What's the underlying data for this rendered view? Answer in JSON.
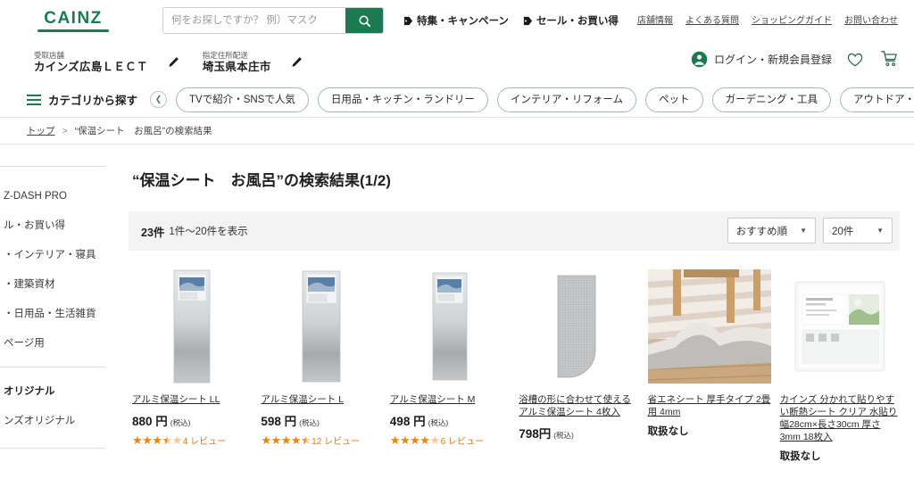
{
  "header": {
    "logo_text": "CAINZ",
    "search": {
      "placeholder": "何をお探しですか？ 例）マスク",
      "value": "",
      "button_icon": "search-icon"
    },
    "promo_links": [
      {
        "label": "特集・キャンペーン",
        "icon": "tag-icon"
      },
      {
        "label": "セール・お買い得",
        "icon": "tag-icon"
      }
    ],
    "util_links": [
      "店舗情報",
      "よくある質問",
      "ショッピングガイド",
      "お問い合わせ"
    ]
  },
  "store_row": {
    "pickup": {
      "label": "受取店舗",
      "value": "カインズ広島ＬＥＣＴ",
      "edit_icon": "pencil-icon"
    },
    "delivery": {
      "label": "指定住所配送",
      "value": "埼玉県本庄市",
      "edit_icon": "pencil-icon"
    },
    "account": {
      "label": "ログイン・新規会員登録",
      "person_icon": "person-icon",
      "favorite_icon": "heart-icon",
      "cart_icon": "cart-icon"
    }
  },
  "category_nav": {
    "menu_label": "カテゴリから探す",
    "prev_icon": "chevron-left-icon",
    "next_icon": "chevron-right-icon",
    "chips": [
      "TVで紹介・SNSで人気",
      "日用品・キッチン・ランドリー",
      "インテリア・リフォーム",
      "ペット",
      "ガーデニング・工具",
      "アウトドア・ス"
    ]
  },
  "breadcrumb": {
    "home": "トップ",
    "separator": ">",
    "current": "“保温シート　お風呂”の検索結果"
  },
  "side_panel": {
    "items": [
      {
        "label": "Z-DASH PRO",
        "bold": false
      },
      {
        "label": "ル・お買い得",
        "bold": false
      },
      {
        "label": "・インテリア・寝具",
        "bold": false
      },
      {
        "label": "・建築資材",
        "bold": false
      },
      {
        "label": "・日用品・生活雑貨",
        "bold": false
      },
      {
        "label": "ページ用",
        "bold": false
      },
      {
        "label": "オリジナル",
        "bold": true
      },
      {
        "label": "ンズオリジナル",
        "bold": false
      }
    ]
  },
  "main": {
    "page_title": "“保温シート　お風呂”の検索結果(1/2)",
    "result_count": "23件",
    "result_range": "1件〜20件を表示",
    "sort_select": {
      "value": "おすすめ順",
      "caret_icon": "chevron-down-icon"
    },
    "perpage_select": {
      "value": "20件",
      "caret_icon": "chevron-down-icon"
    },
    "tax_note": "(税込)",
    "products": [
      {
        "title": "アルミ保温シート LL",
        "price": "880 円",
        "tax": "(税込)",
        "rating": 3.5,
        "review_text": "4 レビュー",
        "in_stock": true,
        "image": "aluminum-sheet-tall"
      },
      {
        "title": "アルミ保温シート L",
        "price": "598 円",
        "tax": "(税込)",
        "rating": 4.5,
        "review_text": "12 レビュー",
        "in_stock": true,
        "image": "aluminum-sheet-tall"
      },
      {
        "title": "アルミ保温シート M",
        "price": "498 円",
        "tax": "(税込)",
        "rating": 4,
        "review_text": "6 レビュー",
        "in_stock": true,
        "image": "aluminum-sheet-tall"
      },
      {
        "title": "浴槽の形に合わせて使える アルミ保温シート 4枚入",
        "price": "798円",
        "tax": "(税込)",
        "rating": 0,
        "review_text": "",
        "in_stock": true,
        "image": "rounded-mat"
      },
      {
        "title": "省エネシート 厚手タイプ 2畳用 4mm",
        "price": "",
        "tax": "",
        "rating": 0,
        "review_text": "",
        "in_stock": false,
        "stock_label": "取扱なし",
        "image": "rug-underlay-photo"
      },
      {
        "title": "カインズ 分かれて貼りやすい断熱シート クリア 水貼り 幅28cm×長さ30cm 厚さ3mm 18枚入",
        "price": "",
        "tax": "",
        "rating": 0,
        "review_text": "",
        "in_stock": false,
        "stock_label": "取扱なし",
        "image": "clear-sheet-package"
      }
    ]
  },
  "colors": {
    "brand_green": "#1b7a51",
    "star_orange": "#f08300",
    "chip_border": "#9fbdae",
    "result_bar_bg": "#f3f3f3"
  }
}
